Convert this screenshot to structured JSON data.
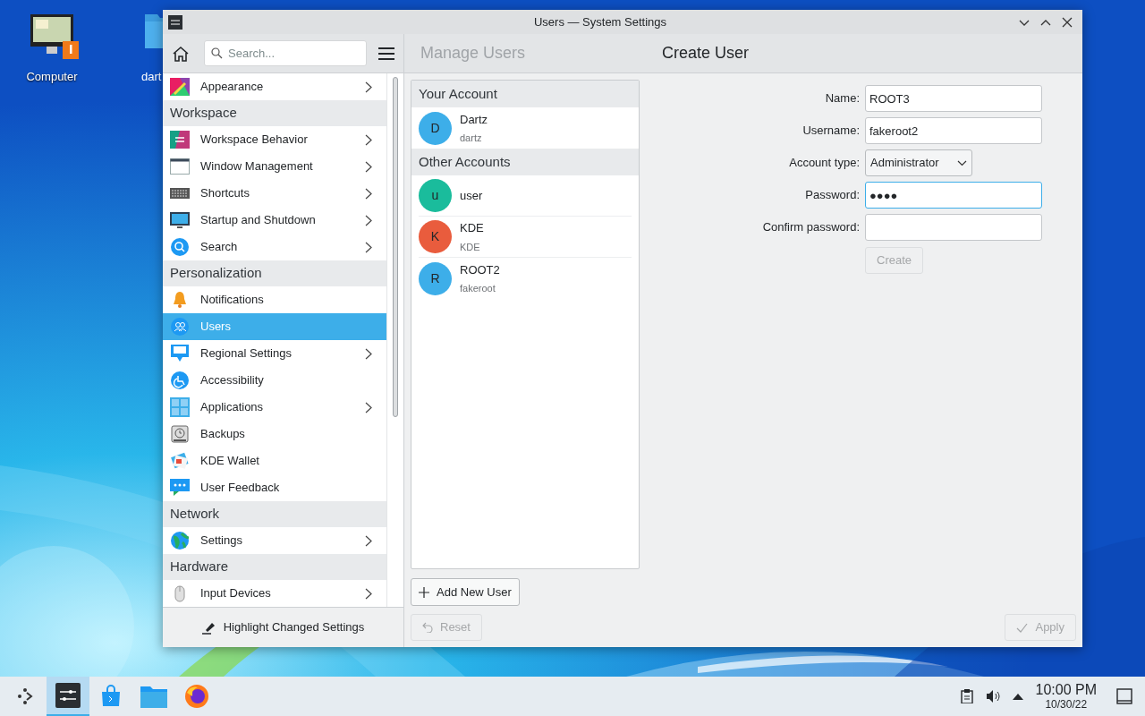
{
  "desktop_icons": [
    {
      "label": "Computer"
    },
    {
      "label": "dart"
    }
  ],
  "window": {
    "title": "Users — System Settings"
  },
  "sidebar": {
    "search": {
      "placeholder": "Search..."
    },
    "items": [
      {
        "kind": "item",
        "label": "Appearance",
        "arrow": true,
        "selected": false
      },
      {
        "kind": "section",
        "label": "Workspace"
      },
      {
        "kind": "item",
        "label": "Workspace Behavior",
        "arrow": true,
        "selected": false
      },
      {
        "kind": "item",
        "label": "Window Management",
        "arrow": true,
        "selected": false
      },
      {
        "kind": "item",
        "label": "Shortcuts",
        "arrow": true,
        "selected": false
      },
      {
        "kind": "item",
        "label": "Startup and Shutdown",
        "arrow": true,
        "selected": false
      },
      {
        "kind": "item",
        "label": "Search",
        "arrow": true,
        "selected": false
      },
      {
        "kind": "section",
        "label": "Personalization"
      },
      {
        "kind": "item",
        "label": "Notifications",
        "arrow": false,
        "selected": false
      },
      {
        "kind": "item",
        "label": "Users",
        "arrow": false,
        "selected": true
      },
      {
        "kind": "item",
        "label": "Regional Settings",
        "arrow": true,
        "selected": false
      },
      {
        "kind": "item",
        "label": "Accessibility",
        "arrow": false,
        "selected": false
      },
      {
        "kind": "item",
        "label": "Applications",
        "arrow": true,
        "selected": false
      },
      {
        "kind": "item",
        "label": "Backups",
        "arrow": false,
        "selected": false
      },
      {
        "kind": "item",
        "label": "KDE Wallet",
        "arrow": false,
        "selected": false
      },
      {
        "kind": "item",
        "label": "User Feedback",
        "arrow": false,
        "selected": false
      },
      {
        "kind": "section",
        "label": "Network"
      },
      {
        "kind": "item",
        "label": "Settings",
        "arrow": true,
        "selected": false
      },
      {
        "kind": "section",
        "label": "Hardware"
      },
      {
        "kind": "item",
        "label": "Input Devices",
        "arrow": true,
        "selected": false
      }
    ],
    "footer_button": "Highlight Changed Settings"
  },
  "breadcrumbs": [
    {
      "label": "Manage Users",
      "selected": false
    },
    {
      "label": "Create User",
      "selected": true
    }
  ],
  "accounts": [
    {
      "title": "Your Account",
      "users": [
        {
          "initial": "D",
          "name": "Dartz",
          "username": "dartz",
          "color": "#3daee9"
        }
      ]
    },
    {
      "title": "Other Accounts",
      "users": [
        {
          "initial": "u",
          "name": "user",
          "color": "#1abc9c"
        },
        {
          "initial": "K",
          "name": "KDE",
          "username": "KDE",
          "color": "#e95c3d"
        },
        {
          "initial": "R",
          "name": "ROOT2",
          "username": "fakeroot",
          "color": "#3daee9"
        }
      ]
    }
  ],
  "add_user_button": "Add New User",
  "form": {
    "fields": [
      {
        "kind": "text",
        "label": "Name:",
        "value": "ROOT3",
        "focused": false
      },
      {
        "kind": "text",
        "label": "Username:",
        "value": "fakeroot2",
        "focused": false
      },
      {
        "kind": "select",
        "label": "Account type:",
        "value": "Administrator"
      },
      {
        "kind": "text",
        "label": "Password:",
        "value": "●●●●",
        "focused": true
      },
      {
        "kind": "text",
        "label": "Confirm password:",
        "focused": false
      }
    ],
    "create_button": {
      "label": "Create",
      "disabled": true
    }
  },
  "reset_button": {
    "label": "Reset",
    "disabled": true
  },
  "apply_button": {
    "label": "Apply",
    "disabled": true
  },
  "taskbar": {
    "tasks": [
      {
        "selected": false
      },
      {
        "selected": true
      },
      {
        "selected": false
      },
      {
        "selected": false
      },
      {
        "selected": false
      }
    ],
    "time": "10:00 PM",
    "date": "10/30/22"
  }
}
